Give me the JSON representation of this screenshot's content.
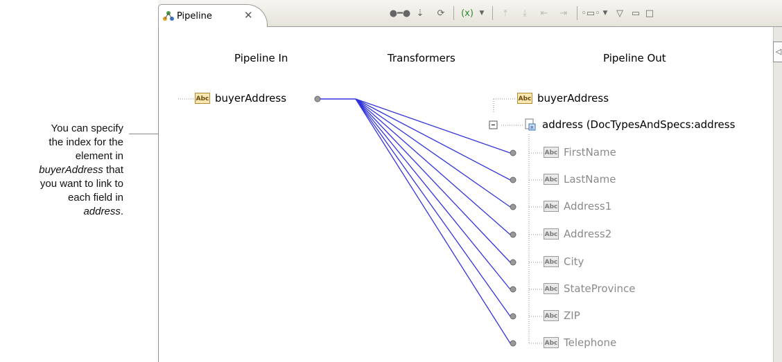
{
  "callout": {
    "line1": "You can specify",
    "line2": "the index for the",
    "line3": "element in",
    "line4_italic": "buyerAddress",
    "line4_rest": " that",
    "line5": "you want to link to",
    "line6": "each field in",
    "line7_italic": "address",
    "line7_rest": "."
  },
  "tab": {
    "label": "Pipeline",
    "close_icon": "close-x"
  },
  "columns": {
    "in": "Pipeline In",
    "transformers": "Transformers",
    "out": "Pipeline Out"
  },
  "pipeline_in": {
    "field": "buyerAddress"
  },
  "pipeline_out": {
    "field": "buyerAddress",
    "document": "address (DocTypesAndSpecs:address",
    "children": [
      "FirstName",
      "LastName",
      "Address1",
      "Address2",
      "City",
      "StateProvince",
      "ZIP",
      "Telephone"
    ]
  },
  "icons": {
    "string": "Abc",
    "expand": "minus-box",
    "colors": {
      "link": "#3333dd",
      "string_fill": "#f8e7b2",
      "string_border": "#b58a2e"
    }
  }
}
